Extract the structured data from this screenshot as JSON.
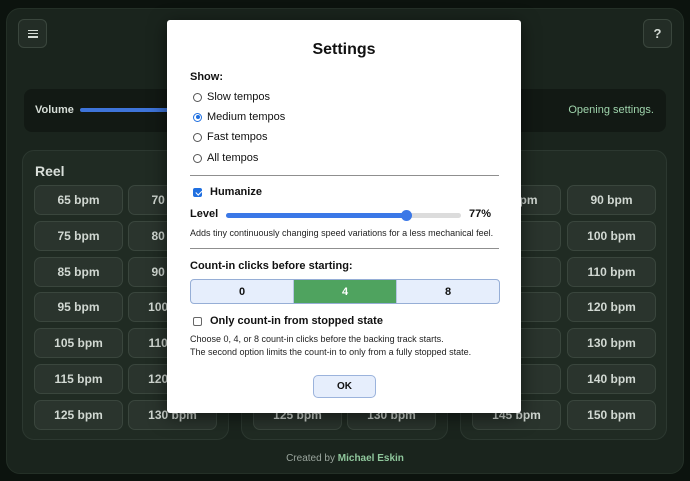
{
  "header": {
    "menu_icon": "hamburger-icon",
    "help_label": "?"
  },
  "volume": {
    "label": "Volume",
    "status": "Opening settings."
  },
  "panels": [
    {
      "title": "Reel",
      "col1": [
        "65 bpm",
        "75 bpm",
        "85 bpm",
        "95 bpm",
        "105 bpm",
        "115 bpm",
        "125 bpm"
      ],
      "col2": [
        "70 bpm",
        "80 bpm",
        "90 bpm",
        "100 bpm",
        "110 bpm",
        "120 bpm",
        "130 bpm"
      ]
    },
    {
      "title": "",
      "col1": [
        "",
        "",
        "",
        "",
        "",
        "",
        "125 bpm"
      ],
      "col2": [
        "",
        "",
        "",
        "",
        "",
        "",
        "130 bpm"
      ]
    },
    {
      "title": "",
      "col1": [
        "85 bpm",
        "",
        "",
        "",
        "",
        "",
        "145 bpm"
      ],
      "col2": [
        "90 bpm",
        "100 bpm",
        "110 bpm",
        "120 bpm",
        "130 bpm",
        "140 bpm",
        "150 bpm"
      ]
    }
  ],
  "footer": {
    "prefix": "Created by",
    "author": "Michael Eskin"
  },
  "settings": {
    "title": "Settings",
    "show_label": "Show:",
    "show_options": [
      {
        "label": "Slow tempos",
        "selected": false
      },
      {
        "label": "Medium tempos",
        "selected": true
      },
      {
        "label": "Fast tempos",
        "selected": false
      },
      {
        "label": "All tempos",
        "selected": false
      }
    ],
    "humanize_label": "Humanize",
    "humanize_checked": true,
    "level_label": "Level",
    "level_value": "77%",
    "level_fraction": 0.77,
    "humanize_hint": "Adds tiny continuously changing speed variations for a less mechanical feel.",
    "countin_label": "Count-in clicks before starting:",
    "countin_options": [
      "0",
      "4",
      "8"
    ],
    "countin_selected": "4",
    "stopped_only_label": "Only count-in from stopped state",
    "stopped_only_checked": false,
    "countin_hint_1": "Choose 0, 4, or 8 count-in clicks before the backing track starts.",
    "countin_hint_2": "The second option limits the count-in to only from a fully stopped state.",
    "ok_label": "OK"
  },
  "colors": {
    "accent": "#3b78e7",
    "selected_segment": "#4fa35f",
    "status": "#9fd4ac"
  }
}
